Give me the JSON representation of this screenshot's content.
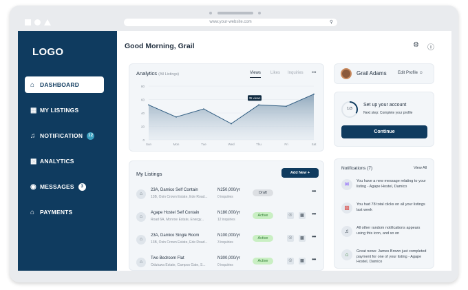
{
  "browser": {
    "url": "www.your-website.com"
  },
  "sidebar": {
    "logo": "LOGO",
    "items": [
      {
        "label": "DASHBOARD",
        "icon": "home-icon",
        "active": true
      },
      {
        "label": "MY LISTINGS",
        "icon": "buildings-icon"
      },
      {
        "label": "NOTIFICATION",
        "icon": "bell-icon",
        "badge": "12"
      },
      {
        "label": "ANALYTICS",
        "icon": "bar-chart-icon"
      },
      {
        "label": "MESSAGES",
        "icon": "chat-icon",
        "badge": "3"
      },
      {
        "label": "PAYMENTS",
        "icon": "bank-icon"
      }
    ]
  },
  "header": {
    "greeting": "Good Morning, Grail"
  },
  "analytics": {
    "title": "Analytics",
    "subtitle": "(All Listings)",
    "tabs": [
      "Views",
      "Likes",
      "Inquiries"
    ],
    "more": "•••"
  },
  "chart_data": {
    "type": "area",
    "categories": [
      "Sun",
      "Mon",
      "Tue",
      "Wed",
      "Thu",
      "Fri",
      "Sat"
    ],
    "values": [
      52,
      34,
      46,
      24,
      52,
      50,
      68
    ],
    "ylim": [
      0,
      80
    ],
    "yticks": [
      0,
      20,
      40,
      60,
      80
    ],
    "tooltip": "35 views",
    "grid": true,
    "xlabel": "",
    "ylabel": ""
  },
  "listings": {
    "title": "My Listings",
    "add_label": "Add New +",
    "rows": [
      {
        "name": "23A, Damico Self Contain",
        "address": "13B, Osin Crown Estate, Ede Road...",
        "price": "N250,000/yr",
        "inquiries": "0 inquiries",
        "status": "Draft"
      },
      {
        "name": "Agape Hostel Self Contain",
        "address": "Road 6A, Monroe Estate, Energy...",
        "price": "N180,000/yr",
        "inquiries": "12 inquiries",
        "status": "Active"
      },
      {
        "name": "23A, Damico Single Room",
        "address": "13B, Osin Crown Estate, Ede Road...",
        "price": "N100,000/yr",
        "inquiries": "3 inquiries",
        "status": "Active"
      },
      {
        "name": "Two Bedroom Flat",
        "address": "Odutuwa Estate, Campos Gate, S...",
        "price": "N300,000/yr",
        "inquiries": "0 inquiries",
        "status": "Active"
      }
    ]
  },
  "profile": {
    "name": "Grail Adams",
    "edit_label": "Edit Profile"
  },
  "setup": {
    "progress": "1/3",
    "progress_fraction": 0.33,
    "title": "Set up your account",
    "subtitle": "Next step: Complete your profile",
    "button": "Continue"
  },
  "notifications": {
    "title": "Notifications (7)",
    "view_all": "View All",
    "items": [
      {
        "text": "You have a new message relating to your listing - Agape Hostel, Damico",
        "icon": "message-icon"
      },
      {
        "text": "You had 78 total clicks on all your listings last week",
        "icon": "chart-icon"
      },
      {
        "text": "All other random notifications appears using this icon, and so on",
        "icon": "bell-icon"
      },
      {
        "text": "Great news: James Brown just completed payment for one of your listing - Agape Hostel, Damico",
        "icon": "payment-icon"
      }
    ]
  }
}
